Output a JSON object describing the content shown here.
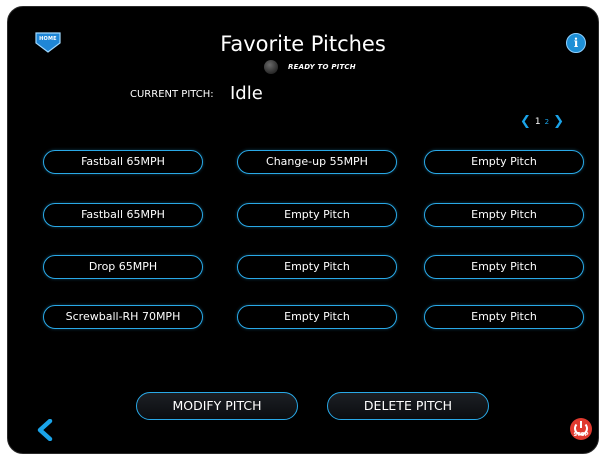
{
  "header": {
    "home_label": "HOME",
    "title": "Favorite Pitches",
    "status_text": "READY TO PITCH",
    "info_glyph": "i"
  },
  "current": {
    "label": "CURRENT PITCH:",
    "value": "Idle"
  },
  "pager": {
    "prev": "❮",
    "page1": "1",
    "page2": "2",
    "next": "❯"
  },
  "pitches": [
    [
      "Fastball 65MPH",
      "Change-up 55MPH",
      "Empty Pitch"
    ],
    [
      "Fastball 65MPH",
      "Empty Pitch",
      "Empty Pitch"
    ],
    [
      "Drop 65MPH",
      "Empty Pitch",
      "Empty Pitch"
    ],
    [
      "Screwball-RH 70MPH",
      "Empty Pitch",
      "Empty Pitch"
    ]
  ],
  "actions": {
    "modify": "MODIFY PITCH",
    "delete": "DELETE PITCH"
  },
  "footer": {
    "stop_label": "STOP"
  },
  "colors": {
    "accent": "#29a8e6",
    "background": "#000000",
    "stop_red": "#e03a2f"
  },
  "icons": {
    "home": "home-icon",
    "info": "info-icon",
    "back": "chevron-left-icon",
    "stop": "power-stop-icon"
  }
}
